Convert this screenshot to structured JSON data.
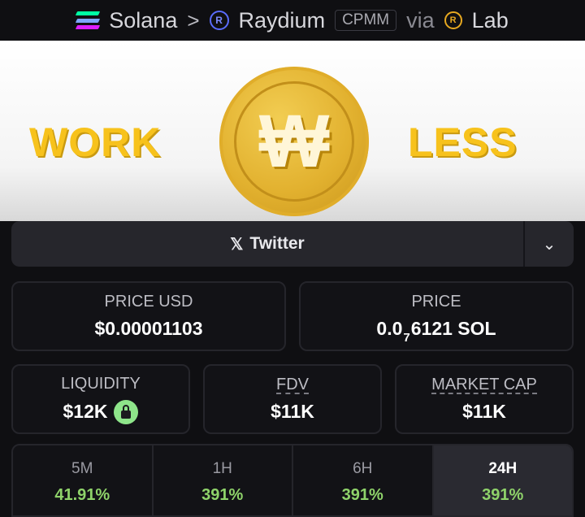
{
  "topbar": {
    "chain": "Solana",
    "separator": ">",
    "dex": "Raydium",
    "pool_type": "CPMM",
    "via": "via",
    "launchpad": "Lab",
    "raydium_icon_glyph": "R",
    "lab_icon_glyph": "R",
    "icons": [
      "solana-icon",
      "raydium-icon",
      "lab-icon"
    ]
  },
  "banner": {
    "left_word": "WORK",
    "right_word": "LESS",
    "coin_symbol": "₩",
    "accent_color": "#f7c21c"
  },
  "social": {
    "twitter_label": "Twitter",
    "x_glyph": "𝕏",
    "chevron_glyph": "⌄"
  },
  "price_usd": {
    "label": "PRICE USD",
    "value": "$0.00001103"
  },
  "price_native": {
    "label": "PRICE",
    "value_prefix": "0.0",
    "value_subscript": "7",
    "value_suffix": "6121 SOL"
  },
  "liquidity": {
    "label": "LIQUIDITY",
    "value": "$12K",
    "locked_icon": "lock-icon"
  },
  "fdv": {
    "label": "FDV",
    "value": "$11K"
  },
  "market_cap": {
    "label": "MARKET CAP",
    "value": "$11K"
  },
  "timeframes": [
    {
      "label": "5M",
      "value": "41.91%"
    },
    {
      "label": "1H",
      "value": "391%"
    },
    {
      "label": "6H",
      "value": "391%"
    },
    {
      "label": "24H",
      "value": "391%",
      "active": true
    }
  ],
  "colors": {
    "positive": "#8fd36a",
    "background": "#0f0f12",
    "card_border": "#25252b"
  }
}
